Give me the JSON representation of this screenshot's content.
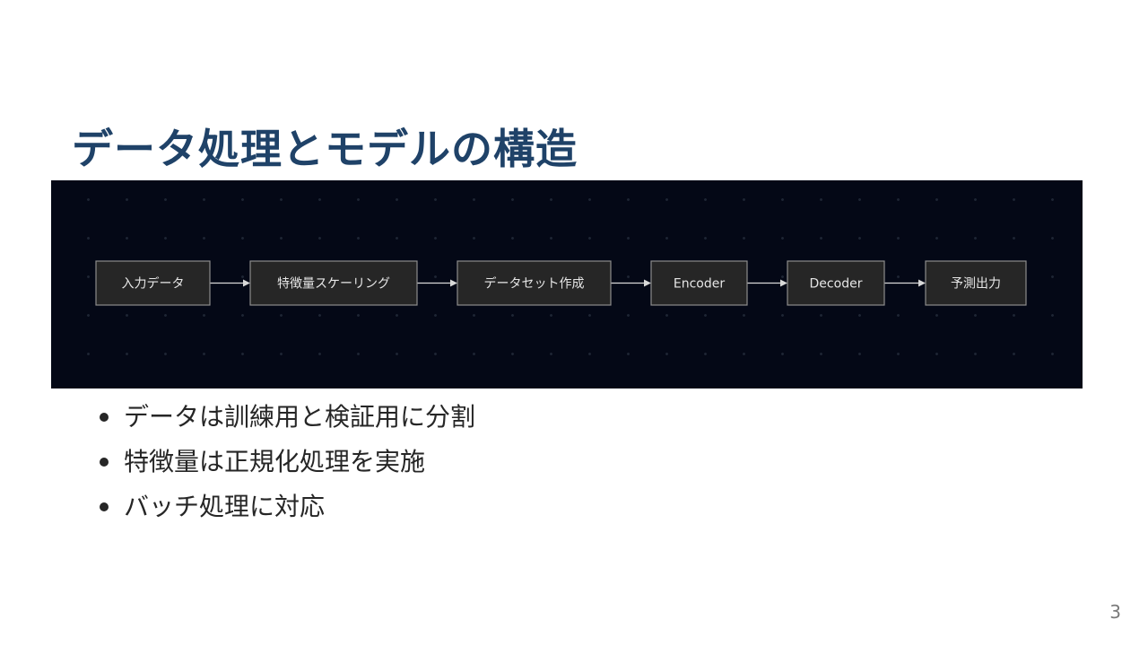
{
  "title": "データ処理とモデルの構造",
  "colors": {
    "title": "#1f4268",
    "panel_background": "#040816",
    "node_fill": "#262626",
    "node_border": "#8c8c8c",
    "node_text": "#e6e6e6",
    "edge": "#d9d9d9"
  },
  "diagram": {
    "nodes": [
      {
        "id": "input",
        "label": "入力データ"
      },
      {
        "id": "scaling",
        "label": "特徴量スケーリング"
      },
      {
        "id": "dataset",
        "label": "データセット作成"
      },
      {
        "id": "encoder",
        "label": "Encoder"
      },
      {
        "id": "decoder",
        "label": "Decoder"
      },
      {
        "id": "output",
        "label": "予測出力"
      }
    ],
    "edges": [
      {
        "from": "input",
        "to": "scaling"
      },
      {
        "from": "scaling",
        "to": "dataset"
      },
      {
        "from": "dataset",
        "to": "encoder"
      },
      {
        "from": "encoder",
        "to": "decoder"
      },
      {
        "from": "decoder",
        "to": "output"
      }
    ]
  },
  "bullets": [
    "データは訓練用と検証用に分割",
    "特徴量は正規化処理を実施",
    "バッチ処理に対応"
  ],
  "page_number": "3"
}
